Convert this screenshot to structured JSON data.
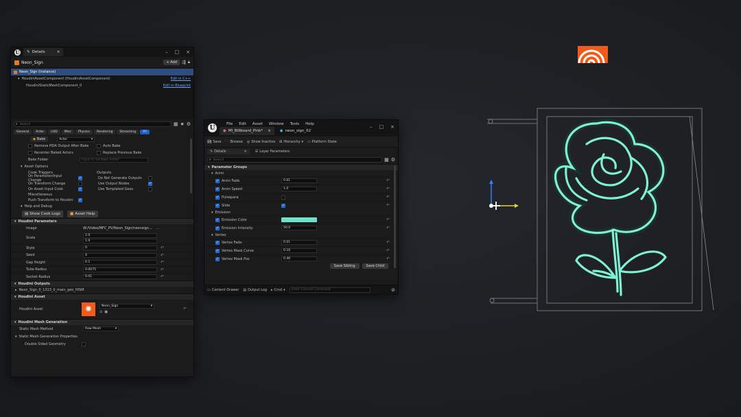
{
  "details": {
    "tab_title": "Details",
    "actor_name": "Neon_Sign",
    "add_label": "+ Add",
    "tree": [
      {
        "label": "Neon_Sign (Instance)",
        "link": ""
      },
      {
        "label": "HoudiniAssetComponent (HoudiniAssetComponent)",
        "link": "Edit in C++"
      },
      {
        "label": "HoudiniStaticMeshComponent_0",
        "link": "Edit in Blueprint"
      }
    ],
    "search_placeholder": "Search",
    "filter_tabs": [
      "General",
      "Actor",
      "LOD",
      "Misc",
      "Physics",
      "Rendering",
      "Streaming",
      "All"
    ],
    "bake_button": "Bake",
    "bake_option": "Actor",
    "bake_checks": [
      {
        "label": "Remove HDA Output After Bake",
        "checked": false
      },
      {
        "label": "Auto Bake",
        "checked": false
      },
      {
        "label": "Recenter Baked Actors",
        "checked": false
      },
      {
        "label": "Replace Previous Bake",
        "checked": false
      }
    ],
    "bake_folder_label": "Bake Folder",
    "bake_folder_placeholder": "Input to set Bake Folder",
    "asset_options_label": "Asset Options",
    "cook_triggers_label": "Cook Triggers",
    "outputs_label": "Outputs",
    "cook_triggers": [
      {
        "label": "On Parameter/Input Change",
        "checked": true
      },
      {
        "label": "On Transform Change",
        "checked": false
      },
      {
        "label": "On Asset Input Cook",
        "checked": true
      }
    ],
    "outputs": [
      {
        "label": "Do Not Generate Outputs",
        "checked": false
      },
      {
        "label": "Use Output Nodes",
        "checked": true
      },
      {
        "label": "Use Templated Geos",
        "checked": false
      }
    ],
    "misc_label": "Miscellaneous",
    "push_transform_label": "Push Transform to Houdini",
    "help_debug_label": "Help and Debug",
    "show_cook_logs": "Show Cook Logs",
    "asset_help": "Asset Help",
    "houdini_params_header": "Houdini Parameters",
    "params": [
      {
        "label": "Image",
        "value": "W:/Video/MFC_PV/Neon_Sign/neonsign..."
      },
      {
        "label": "Scale",
        "value": "2.0",
        "value2": "1.0"
      },
      {
        "label": "Style",
        "value": "0"
      },
      {
        "label": "Seed",
        "value": "4"
      },
      {
        "label": "Gap Height",
        "value": "0.1"
      },
      {
        "label": "Tube Radius",
        "value": "0.0075"
      },
      {
        "label": "Socket Radius",
        "value": "0.01"
      }
    ],
    "houdini_outputs_header": "Houdini Outputs",
    "output_item": "Neon_Sign_0_1313_0_main_geo_HISM",
    "houdini_asset_header": "Houdini Asset",
    "houdini_asset_label": "Houdini Asset",
    "houdini_asset_value": "Neon_Sign",
    "mesh_gen_header": "Houdini Mesh Generation",
    "static_mesh_method_label": "Static Mesh Method",
    "static_mesh_method_value": "Raw Mesh",
    "static_mesh_props_label": "Static Mesh Generation Properties",
    "double_sided_label": "Double Sided Geometry"
  },
  "material": {
    "menu": [
      "File",
      "Edit",
      "Asset",
      "Window",
      "Tools",
      "Help"
    ],
    "tab1": "MI_Billboard_Pink*",
    "tab2": "neon_sign_02",
    "toolbar": [
      "Save",
      "Browse",
      "Show Inactive",
      "Hierarchy",
      "Platform State"
    ],
    "subtab1": "Details",
    "subtab2": "Layer Parameters",
    "search_placeholder": "Search",
    "param_groups_label": "Parameter Groups",
    "anim_label": "Anim",
    "anim_params": [
      {
        "label": "Anim Fade",
        "value": "0.01"
      },
      {
        "label": "Anim Speed",
        "value": "1.0"
      },
      {
        "label": "Pulsepara",
        "value": ""
      },
      {
        "label": "Slide",
        "value": ""
      }
    ],
    "emission_label": "Emission",
    "emission_params": [
      {
        "label": "Emission Color",
        "value": ""
      },
      {
        "label": "Emission Intensity",
        "value": "50.0"
      }
    ],
    "emission_color": "#6fe3c9",
    "vertex_label": "Vertex",
    "vertex_params": [
      {
        "label": "Vertex Fade",
        "value": "0.01"
      },
      {
        "label": "Vertex Mask Curve",
        "value": "0.16"
      },
      {
        "label": "Vertex Mask Pos",
        "value": "0.46"
      }
    ],
    "save_sibling": "Save Sibling",
    "save_child": "Save Child",
    "content_drawer": "Content Drawer",
    "output_log": "Output Log",
    "cmd_label": "Cmd",
    "console_placeholder": "Enter Console Command"
  },
  "colors": {
    "neon": "#7ef0d4",
    "selection": "#2e4d7a",
    "accent_blue": "#1d5fc4",
    "houdini_orange": "#f05a1a"
  }
}
